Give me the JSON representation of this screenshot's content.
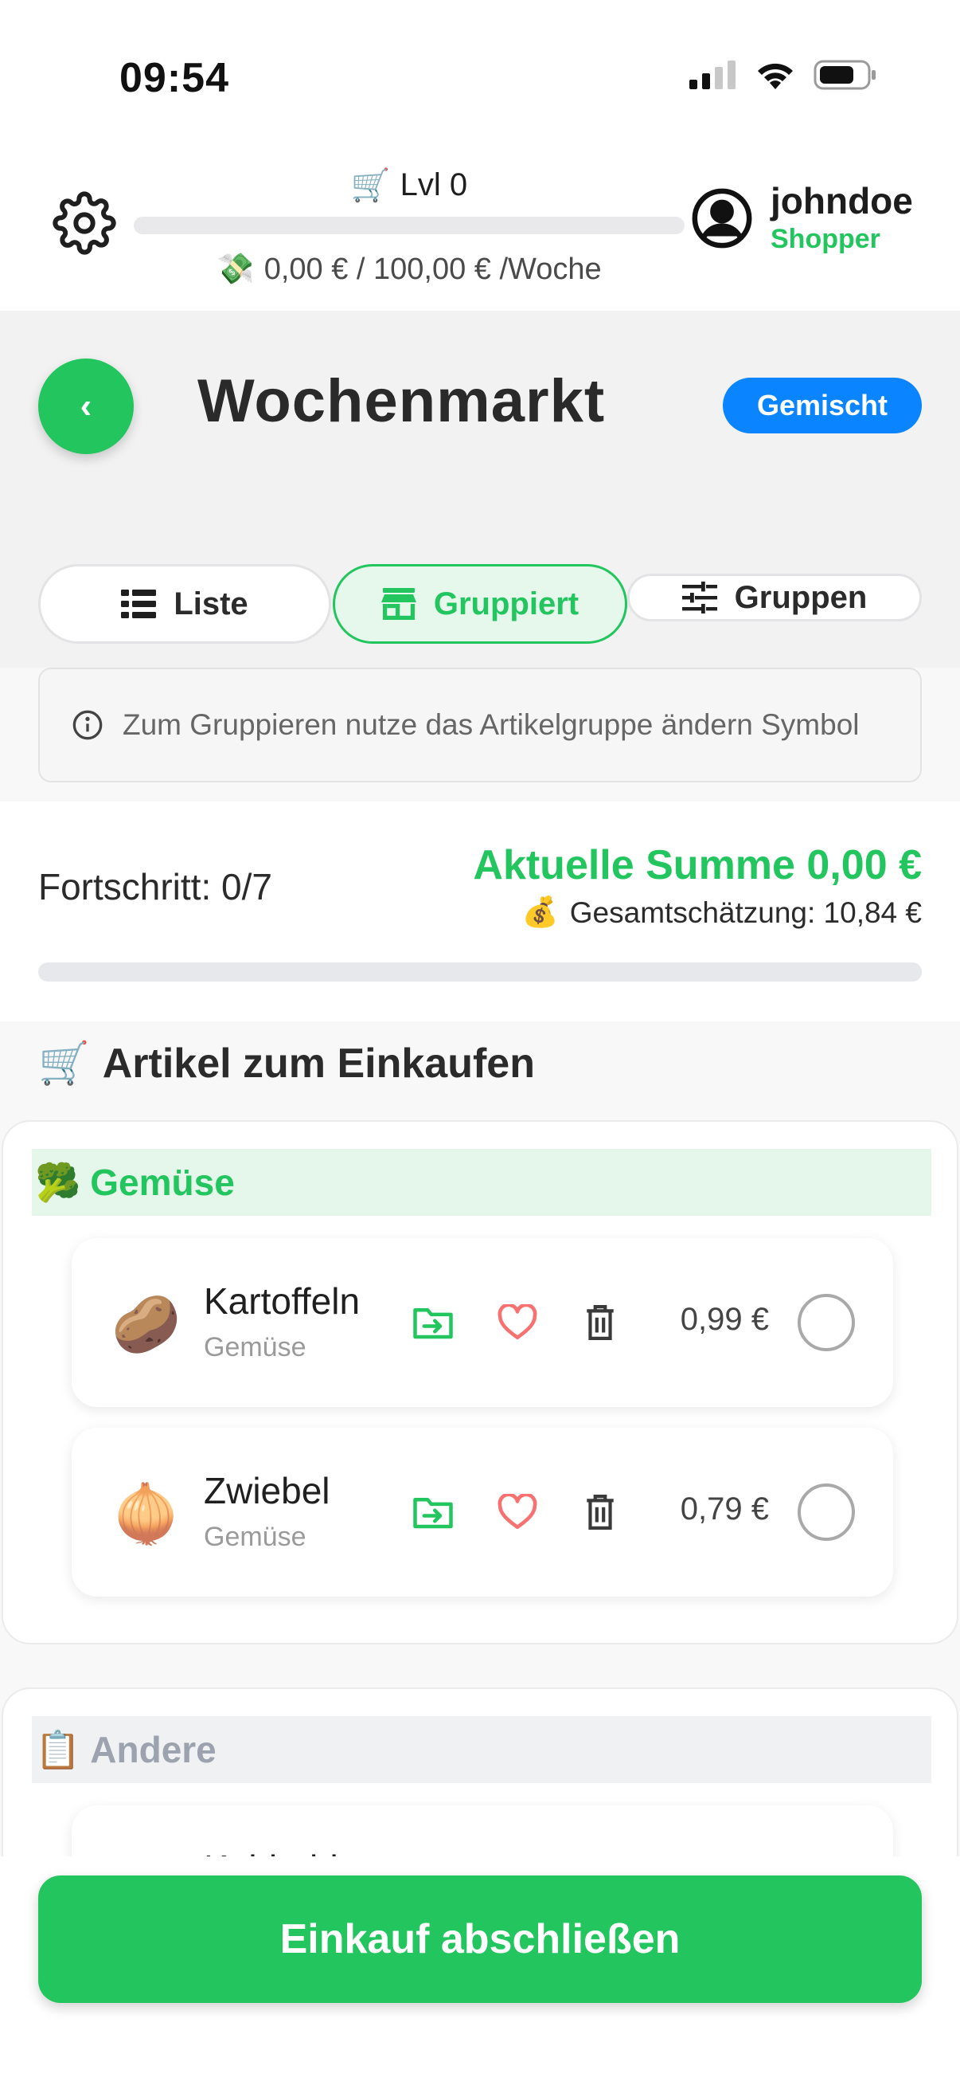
{
  "status_bar": {
    "time": "09:54"
  },
  "header": {
    "level_emoji": "🛒",
    "level_label": "Lvl 0",
    "level_progress": 0,
    "budget_emoji": "💸",
    "budget_text": "0,00 € / 100,00 € /Woche",
    "user_name": "johndoe",
    "user_role": "Shopper"
  },
  "page": {
    "back_label": "‹",
    "title": "Wochenmarkt",
    "mode_badge": "Gemischt"
  },
  "tabs": [
    {
      "label": "Liste",
      "icon": "list-icon",
      "active": false
    },
    {
      "label": "Gruppiert",
      "icon": "store-icon",
      "active": true
    },
    {
      "label": "Gruppen",
      "icon": "sliders-icon",
      "active": false
    }
  ],
  "hint": {
    "text": "Zum Gruppieren nutze das Artikelgruppe ändern Symbol"
  },
  "progress": {
    "label": "Fortschritt: 0/7",
    "current_sum": "Aktuelle Summe 0,00 €",
    "estimate_emoji": "💰",
    "estimate": "Gesamtschätzung: 10,84 €",
    "fraction": 0
  },
  "section": {
    "emoji": "🛒",
    "title": "Artikel zum Einkaufen"
  },
  "groups": [
    {
      "emoji": "🥦",
      "name": "Gemüse",
      "items": [
        {
          "emoji": "🥔",
          "name": "Kartoffeln",
          "group": "Gemüse",
          "price": "0,99 €"
        },
        {
          "emoji": "🧅",
          "name": "Zwiebel",
          "group": "Gemüse",
          "price": "0,79 €"
        }
      ]
    },
    {
      "emoji": "📋",
      "name": "Andere",
      "items": [
        {
          "emoji": "",
          "name": "Kohlrabi",
          "group": "",
          "price": ""
        }
      ]
    }
  ],
  "colors": {
    "accent": "#22c55e",
    "badge": "#0a84ff",
    "heart": "#f87171"
  },
  "cta": {
    "label": "Einkauf abschließen"
  }
}
